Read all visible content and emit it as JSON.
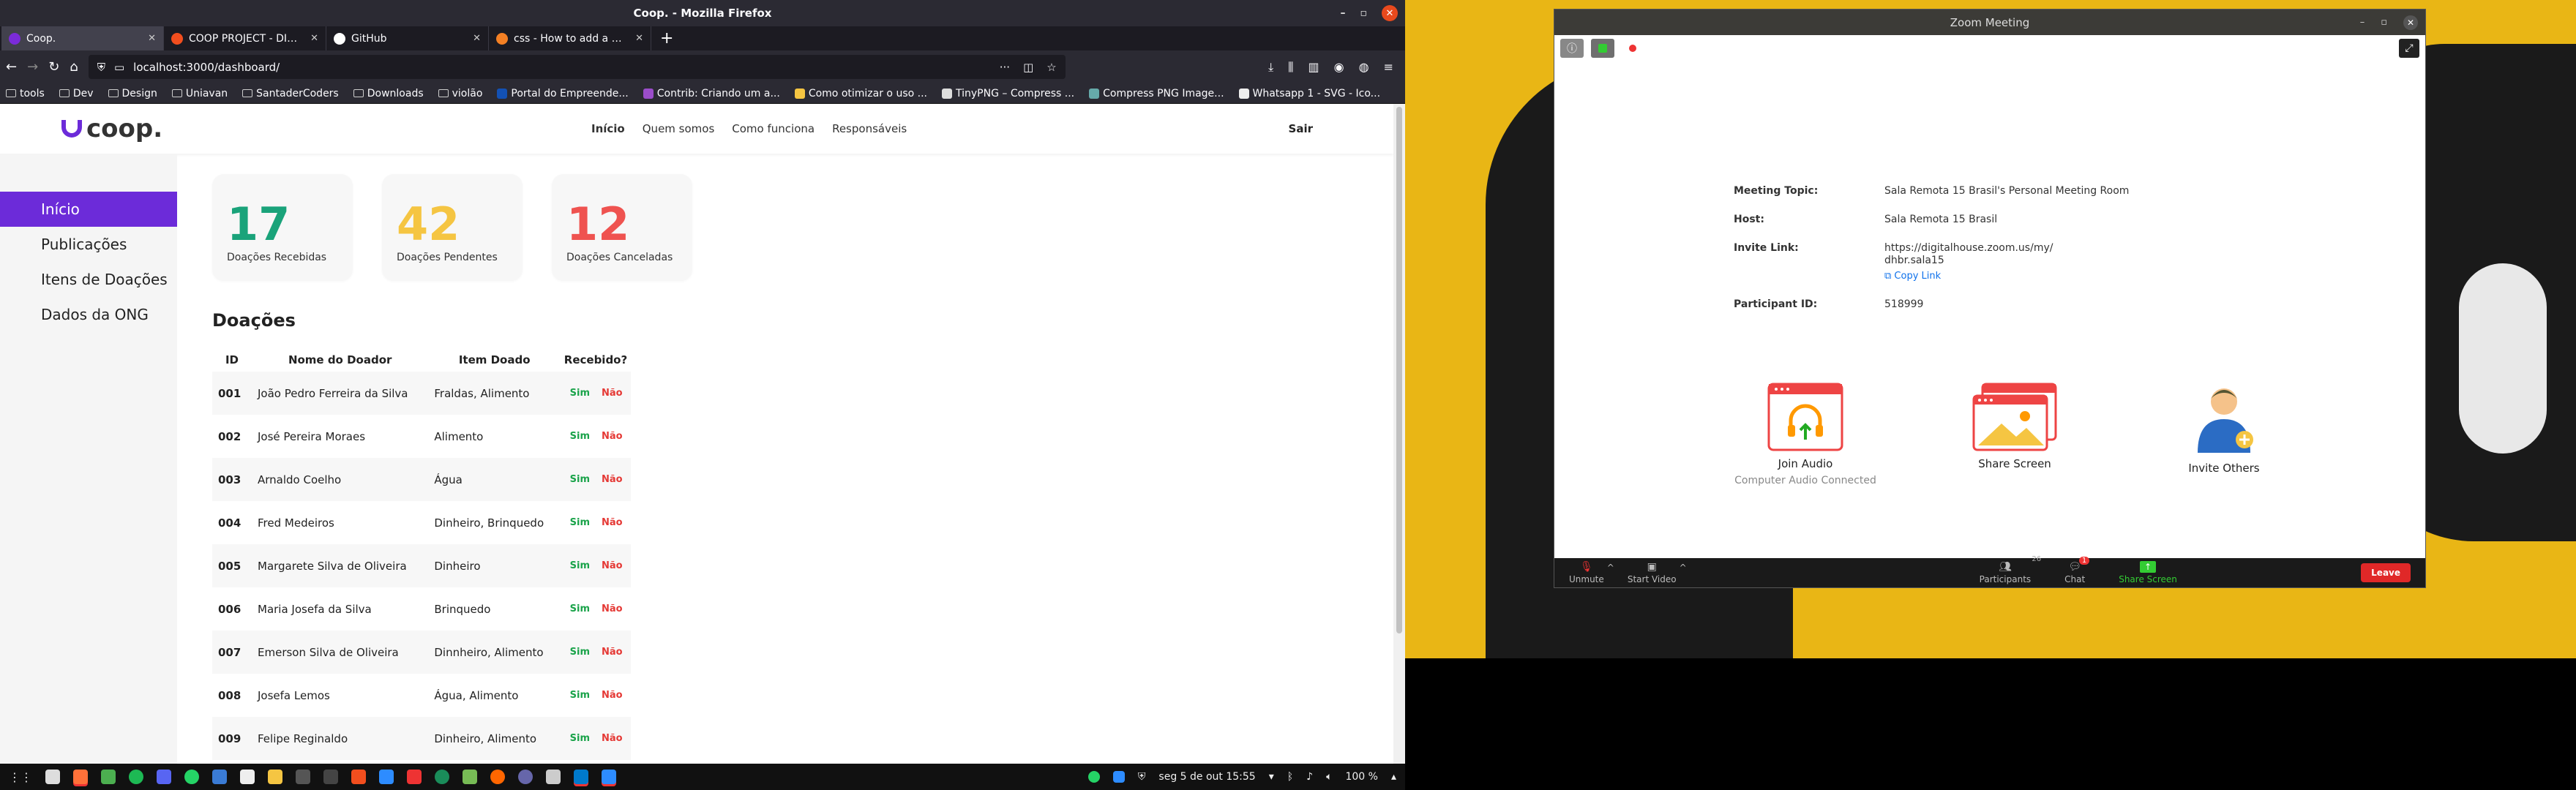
{
  "firefox": {
    "window_title": "Coop. - Mozilla Firefox",
    "tabs": [
      {
        "label": "Coop.",
        "active": true,
        "color": "#7b2bd9"
      },
      {
        "label": "COOP PROJECT - DIGITA",
        "active": false,
        "color": "#f24e1e"
      },
      {
        "label": "GitHub",
        "active": false,
        "color": "#fff"
      },
      {
        "label": "css - How to add a marg",
        "active": false,
        "color": "#f48024"
      }
    ],
    "url": "localhost:3000/dashboard/",
    "bookmarks": [
      {
        "label": "tools",
        "icon": "folder-icon"
      },
      {
        "label": "Dev",
        "icon": "folder-icon"
      },
      {
        "label": "Design",
        "icon": "folder-icon"
      },
      {
        "label": "Uniavan",
        "icon": "folder-icon"
      },
      {
        "label": "SantaderCoders",
        "icon": "folder-icon"
      },
      {
        "label": "Downloads",
        "icon": "folder-icon"
      },
      {
        "label": "violão",
        "icon": "folder-icon"
      },
      {
        "label": "Portal do Empreende...",
        "icon": "gov-icon"
      },
      {
        "label": "Contrib: Criando um a...",
        "icon": "contrib-icon"
      },
      {
        "label": "Como otimizar o uso ...",
        "icon": "star-icon"
      },
      {
        "label": "TinyPNG – Compress ...",
        "icon": "panda-icon"
      },
      {
        "label": "Compress PNG Image...",
        "icon": "png-icon"
      },
      {
        "label": "Whatsapp 1 - SVG - Ico...",
        "icon": "svg-icon"
      }
    ]
  },
  "site": {
    "logo": "coop.",
    "nav": [
      "Início",
      "Quem somos",
      "Como funciona",
      "Responsáveis"
    ],
    "logout": "Sair",
    "sidebar": [
      "Início",
      "Publicações",
      "Itens de Doações",
      "Dados da ONG"
    ],
    "cards": [
      {
        "value": "17",
        "label": "Doações Recebidas",
        "color": "#1aa37a"
      },
      {
        "value": "42",
        "label": "Doações Pendentes",
        "color": "#f5c542"
      },
      {
        "value": "12",
        "label": "Doações Canceladas",
        "color": "#ef5350"
      }
    ],
    "section_title": "Doações",
    "table": {
      "headers": [
        "ID",
        "Nome do Doador",
        "Item Doado",
        "Recebido?"
      ],
      "yes": "Sim",
      "no": "Não",
      "rows": [
        [
          "001",
          "João Pedro Ferreira da Silva",
          "Fraldas, Alimento"
        ],
        [
          "002",
          "José Pereira Moraes",
          "Alimento"
        ],
        [
          "003",
          "Arnaldo Coelho",
          "Água"
        ],
        [
          "004",
          "Fred Medeiros",
          "Dinheiro, Brinquedo"
        ],
        [
          "005",
          "Margarete Silva de Oliveira",
          "Dinheiro"
        ],
        [
          "006",
          "Maria Josefa da Silva",
          "Brinquedo"
        ],
        [
          "007",
          "Emerson Silva de Oliveira",
          "Dinnheiro, Alimento"
        ],
        [
          "008",
          "Josefa Lemos",
          "Água, Alimento"
        ],
        [
          "009",
          "Felipe Reginaldo",
          "Dinheiro, Alimento"
        ]
      ]
    }
  },
  "taskbar": {
    "datetime": "seg 5 de out  15:55",
    "battery": "100 %"
  },
  "zoom": {
    "window_title": "Zoom Meeting",
    "meeting_topic_label": "Meeting Topic:",
    "meeting_topic": "Sala Remota 15 Brasil's Personal Meeting Room",
    "host_label": "Host:",
    "host": "Sala Remota 15 Brasil",
    "invite_label": "Invite Link:",
    "invite_link_1": "https://digitalhouse.zoom.us/my/",
    "invite_link_2": "dhbr.sala15",
    "copy_link": "Copy Link",
    "participant_id_label": "Participant ID:",
    "participant_id": "518999",
    "join_audio": "Join Audio",
    "audio_status": "Computer Audio Connected",
    "share_screen": "Share Screen",
    "invite_others": "Invite Others",
    "toolbar": {
      "unmute": "Unmute",
      "start_video": "Start Video",
      "participants": "Participants",
      "participants_count": "26",
      "chat": "Chat",
      "chat_badge": "1",
      "share_screen": "Share Screen",
      "leave": "Leave"
    }
  }
}
